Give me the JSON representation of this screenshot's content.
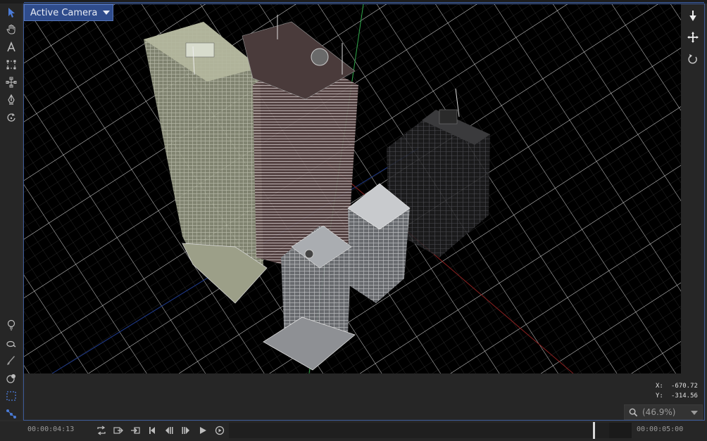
{
  "viewport": {
    "camera_label": "Active Camera"
  },
  "readout": {
    "x_label": "X:",
    "x_value": "-670.72",
    "y_label": "Y:",
    "y_value": "-314.56"
  },
  "zoom": {
    "label": "(46.9%)",
    "percent": 46.9
  },
  "timeline": {
    "current_time": "00:00:04:13",
    "end_time": "00:00:05:00",
    "playhead_fraction": 0.905
  },
  "colors": {
    "accent": "#3d5b9a",
    "camera_menu_bg": "#2f4c8c",
    "tool_selected": "#4b7bd6",
    "grid": "#d8d8d8",
    "axis_y": "#2fa84a",
    "axis_x": "#b23030"
  },
  "icons": {
    "left_tools": [
      "select-arrow-icon",
      "pan-hand-icon",
      "text-tool-icon",
      "transform-box-icon",
      "anchor-points-icon",
      "pen-tool-icon",
      "rotate-tool-icon",
      "light-bulb-icon",
      "zoom-tool-icon",
      "brush-icon",
      "mask-ellipse-icon",
      "marquee-select-icon",
      "connect-nodes-icon"
    ],
    "nav_tools": [
      "dolly-icon",
      "move-icon",
      "orbit-icon"
    ],
    "transport": [
      "loop-icon",
      "export-frame-icon",
      "import-frame-icon",
      "skip-to-start-icon",
      "step-back-icon",
      "step-forward-icon",
      "play-icon",
      "record-icon"
    ]
  }
}
